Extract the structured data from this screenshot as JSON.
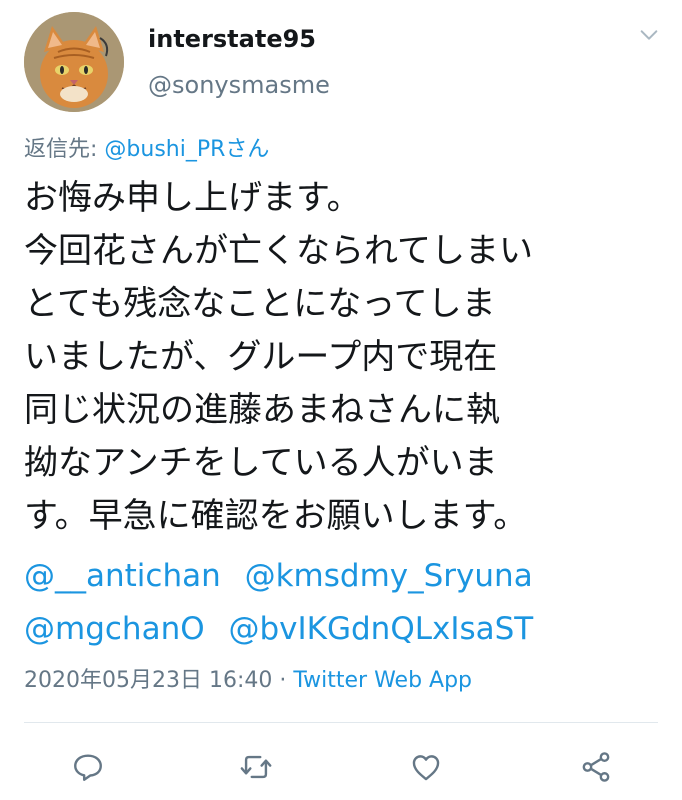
{
  "user": {
    "display_name": "interstate95",
    "handle": "@sonysmasme",
    "avatar_icon": "cat-avatar",
    "menu_icon": "chevron-down-icon"
  },
  "reply": {
    "prefix": "返信先: ",
    "to": "@bushi_PRさん"
  },
  "tweet": {
    "lines": [
      "お悔み申し上げます。",
      "今回花さんが亡くなられてしまい",
      "とても残念なことになってしま",
      "いましたが、グループ内で現在",
      "同じ状況の進藤あまねさんに執",
      "拗なアンチをしている人がいま",
      "す。早急に確認をお願いします。"
    ],
    "mentions": [
      [
        "@__antichan",
        "@kmsdmy_Sryuna"
      ],
      [
        "@mgchanO",
        "@bvIKGdnQLxIsaST"
      ]
    ]
  },
  "meta": {
    "timestamp": "2020年05月23日 16:40",
    "separator": " · ",
    "source": "Twitter Web App"
  },
  "actions": [
    {
      "name": "reply-icon"
    },
    {
      "name": "retweet-icon"
    },
    {
      "name": "like-icon"
    },
    {
      "name": "share-icon"
    }
  ],
  "colors": {
    "text": "#14171a",
    "muted": "#657786",
    "link": "#1b95e0",
    "divider": "#e1e8ed",
    "icon": "#657786"
  }
}
